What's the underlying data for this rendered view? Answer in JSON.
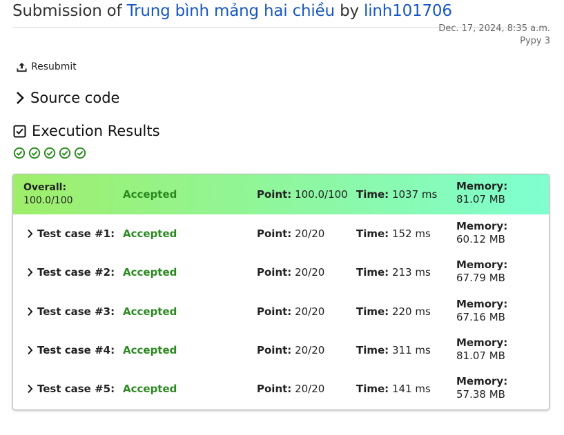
{
  "header": {
    "prefix": "Submission of",
    "problem": "Trung bình mảng hai chiều",
    "by": "by",
    "user": "linh101706",
    "date": "Dec. 17, 2024, 8:35 a.m.",
    "language": "Pypy 3"
  },
  "actions": {
    "resubmit": "Resubmit"
  },
  "sections": {
    "source": "Source code",
    "execution": "Execution Results"
  },
  "labels": {
    "point": "Point:",
    "time": "Time:",
    "memory": "Memory:"
  },
  "overall": {
    "label": "Overall:",
    "score": "100.0/100",
    "status": "Accepted",
    "point": "100.0/100",
    "time": "1037 ms",
    "memory": "81.07 MB"
  },
  "cases": [
    {
      "name": "Test case #1:",
      "status": "Accepted",
      "point": "20/20",
      "time": "152 ms",
      "memory": "60.12 MB"
    },
    {
      "name": "Test case #2:",
      "status": "Accepted",
      "point": "20/20",
      "time": "213 ms",
      "memory": "67.79 MB"
    },
    {
      "name": "Test case #3:",
      "status": "Accepted",
      "point": "20/20",
      "time": "220 ms",
      "memory": "67.16 MB"
    },
    {
      "name": "Test case #4:",
      "status": "Accepted",
      "point": "20/20",
      "time": "311 ms",
      "memory": "81.07 MB"
    },
    {
      "name": "Test case #5:",
      "status": "Accepted",
      "point": "20/20",
      "time": "141 ms",
      "memory": "57.38 MB"
    }
  ],
  "colors": {
    "link": "#1958c1",
    "accepted": "#2a8a1f",
    "overall_from": "#9fee6a",
    "overall_to": "#7fffd0"
  },
  "icons": {
    "resubmit": "upload-icon",
    "source": "chevron-right-icon",
    "execution": "checkbox-checked-icon",
    "case": "check-circle-icon"
  }
}
